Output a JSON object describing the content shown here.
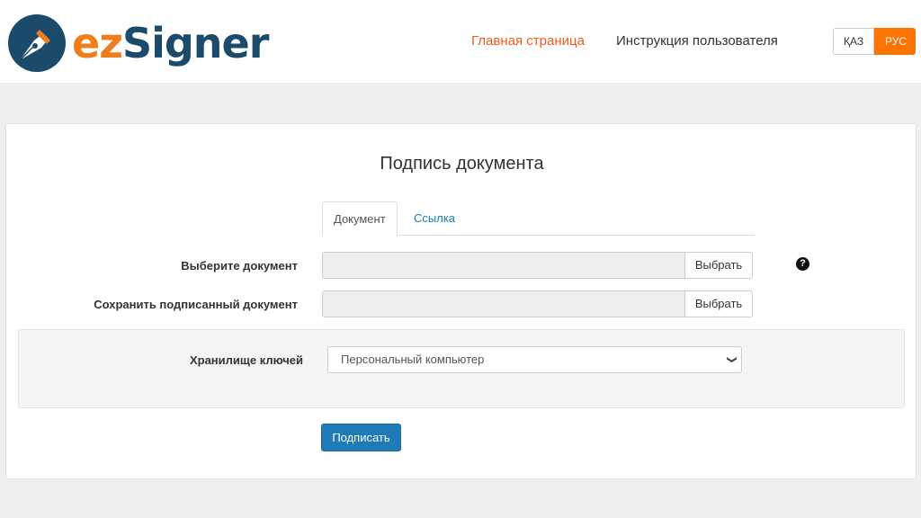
{
  "header": {
    "logo": {
      "part1": "ez",
      "part2": "Signer"
    },
    "nav": {
      "home": "Главная страница",
      "guide": "Инструкция пользователя"
    },
    "lang": {
      "kz": "ҚАЗ",
      "ru": "РУС",
      "active": "ru"
    }
  },
  "main": {
    "title": "Подпись документа",
    "tabs": [
      {
        "label": "Документ",
        "active": true
      },
      {
        "label": "Ссылка",
        "active": false
      }
    ],
    "choose_document": {
      "label": "Выберите документ",
      "value": "",
      "button": "Выбрать"
    },
    "save_document": {
      "label": "Сохранить подписанный документ",
      "value": "",
      "button": "Выбрать"
    },
    "help_icon": "question-circle-icon",
    "key_storage": {
      "label": "Хранилище ключей",
      "selected": "Персональный компьютер"
    },
    "sign_button": "Подписать"
  },
  "colors": {
    "accent_orange": "#fd7400",
    "nav_active": "#f25a1e",
    "primary_blue": "#1f7ab8",
    "logo_dark": "#1b4a6b"
  }
}
